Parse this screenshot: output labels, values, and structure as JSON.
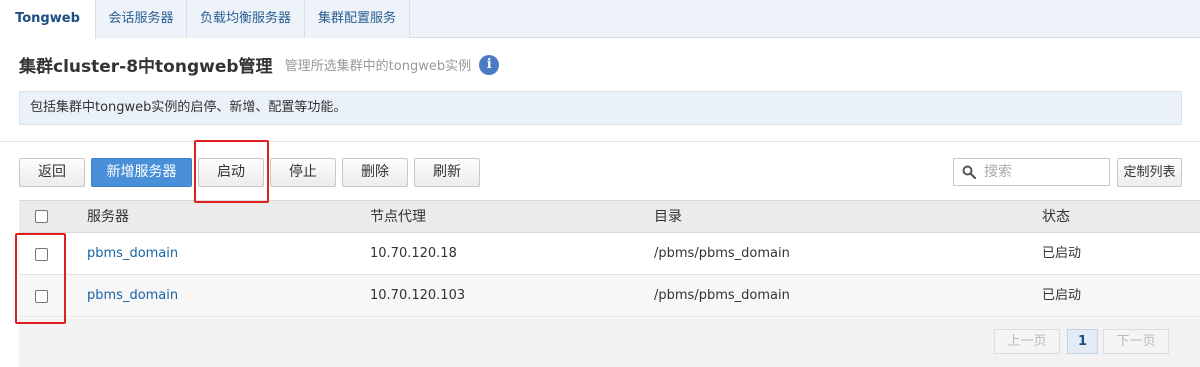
{
  "tabs": [
    {
      "label": "Tongweb"
    },
    {
      "label": "会话服务器"
    },
    {
      "label": "负载均衡服务器"
    },
    {
      "label": "集群配置服务"
    }
  ],
  "header": {
    "title": "集群cluster-8中tongweb管理",
    "subtitle": "管理所选集群中的tongweb实例",
    "info_icon": "i"
  },
  "description": "包括集群中tongweb实例的启停、新增、配置等功能。",
  "toolbar": {
    "back": "返回",
    "add_server": "新增服务器",
    "start": "启动",
    "stop": "停止",
    "delete": "删除",
    "refresh": "刷新",
    "search_placeholder": "搜索",
    "customize_columns": "定制列表"
  },
  "table": {
    "columns": [
      "服务器",
      "节点代理",
      "目录",
      "状态"
    ],
    "rows": [
      {
        "server": "pbms_domain",
        "agent": "10.70.120.18",
        "dir": "/pbms/pbms_domain",
        "status": "已启动"
      },
      {
        "server": "pbms_domain",
        "agent": "10.70.120.103",
        "dir": "/pbms/pbms_domain",
        "status": "已启动"
      }
    ]
  },
  "pagination": {
    "prev": "上一页",
    "current": "1",
    "next": "下一页"
  },
  "colors": {
    "primary": "#4a90d9",
    "link": "#1a63a5",
    "highlight": "#e02020"
  }
}
